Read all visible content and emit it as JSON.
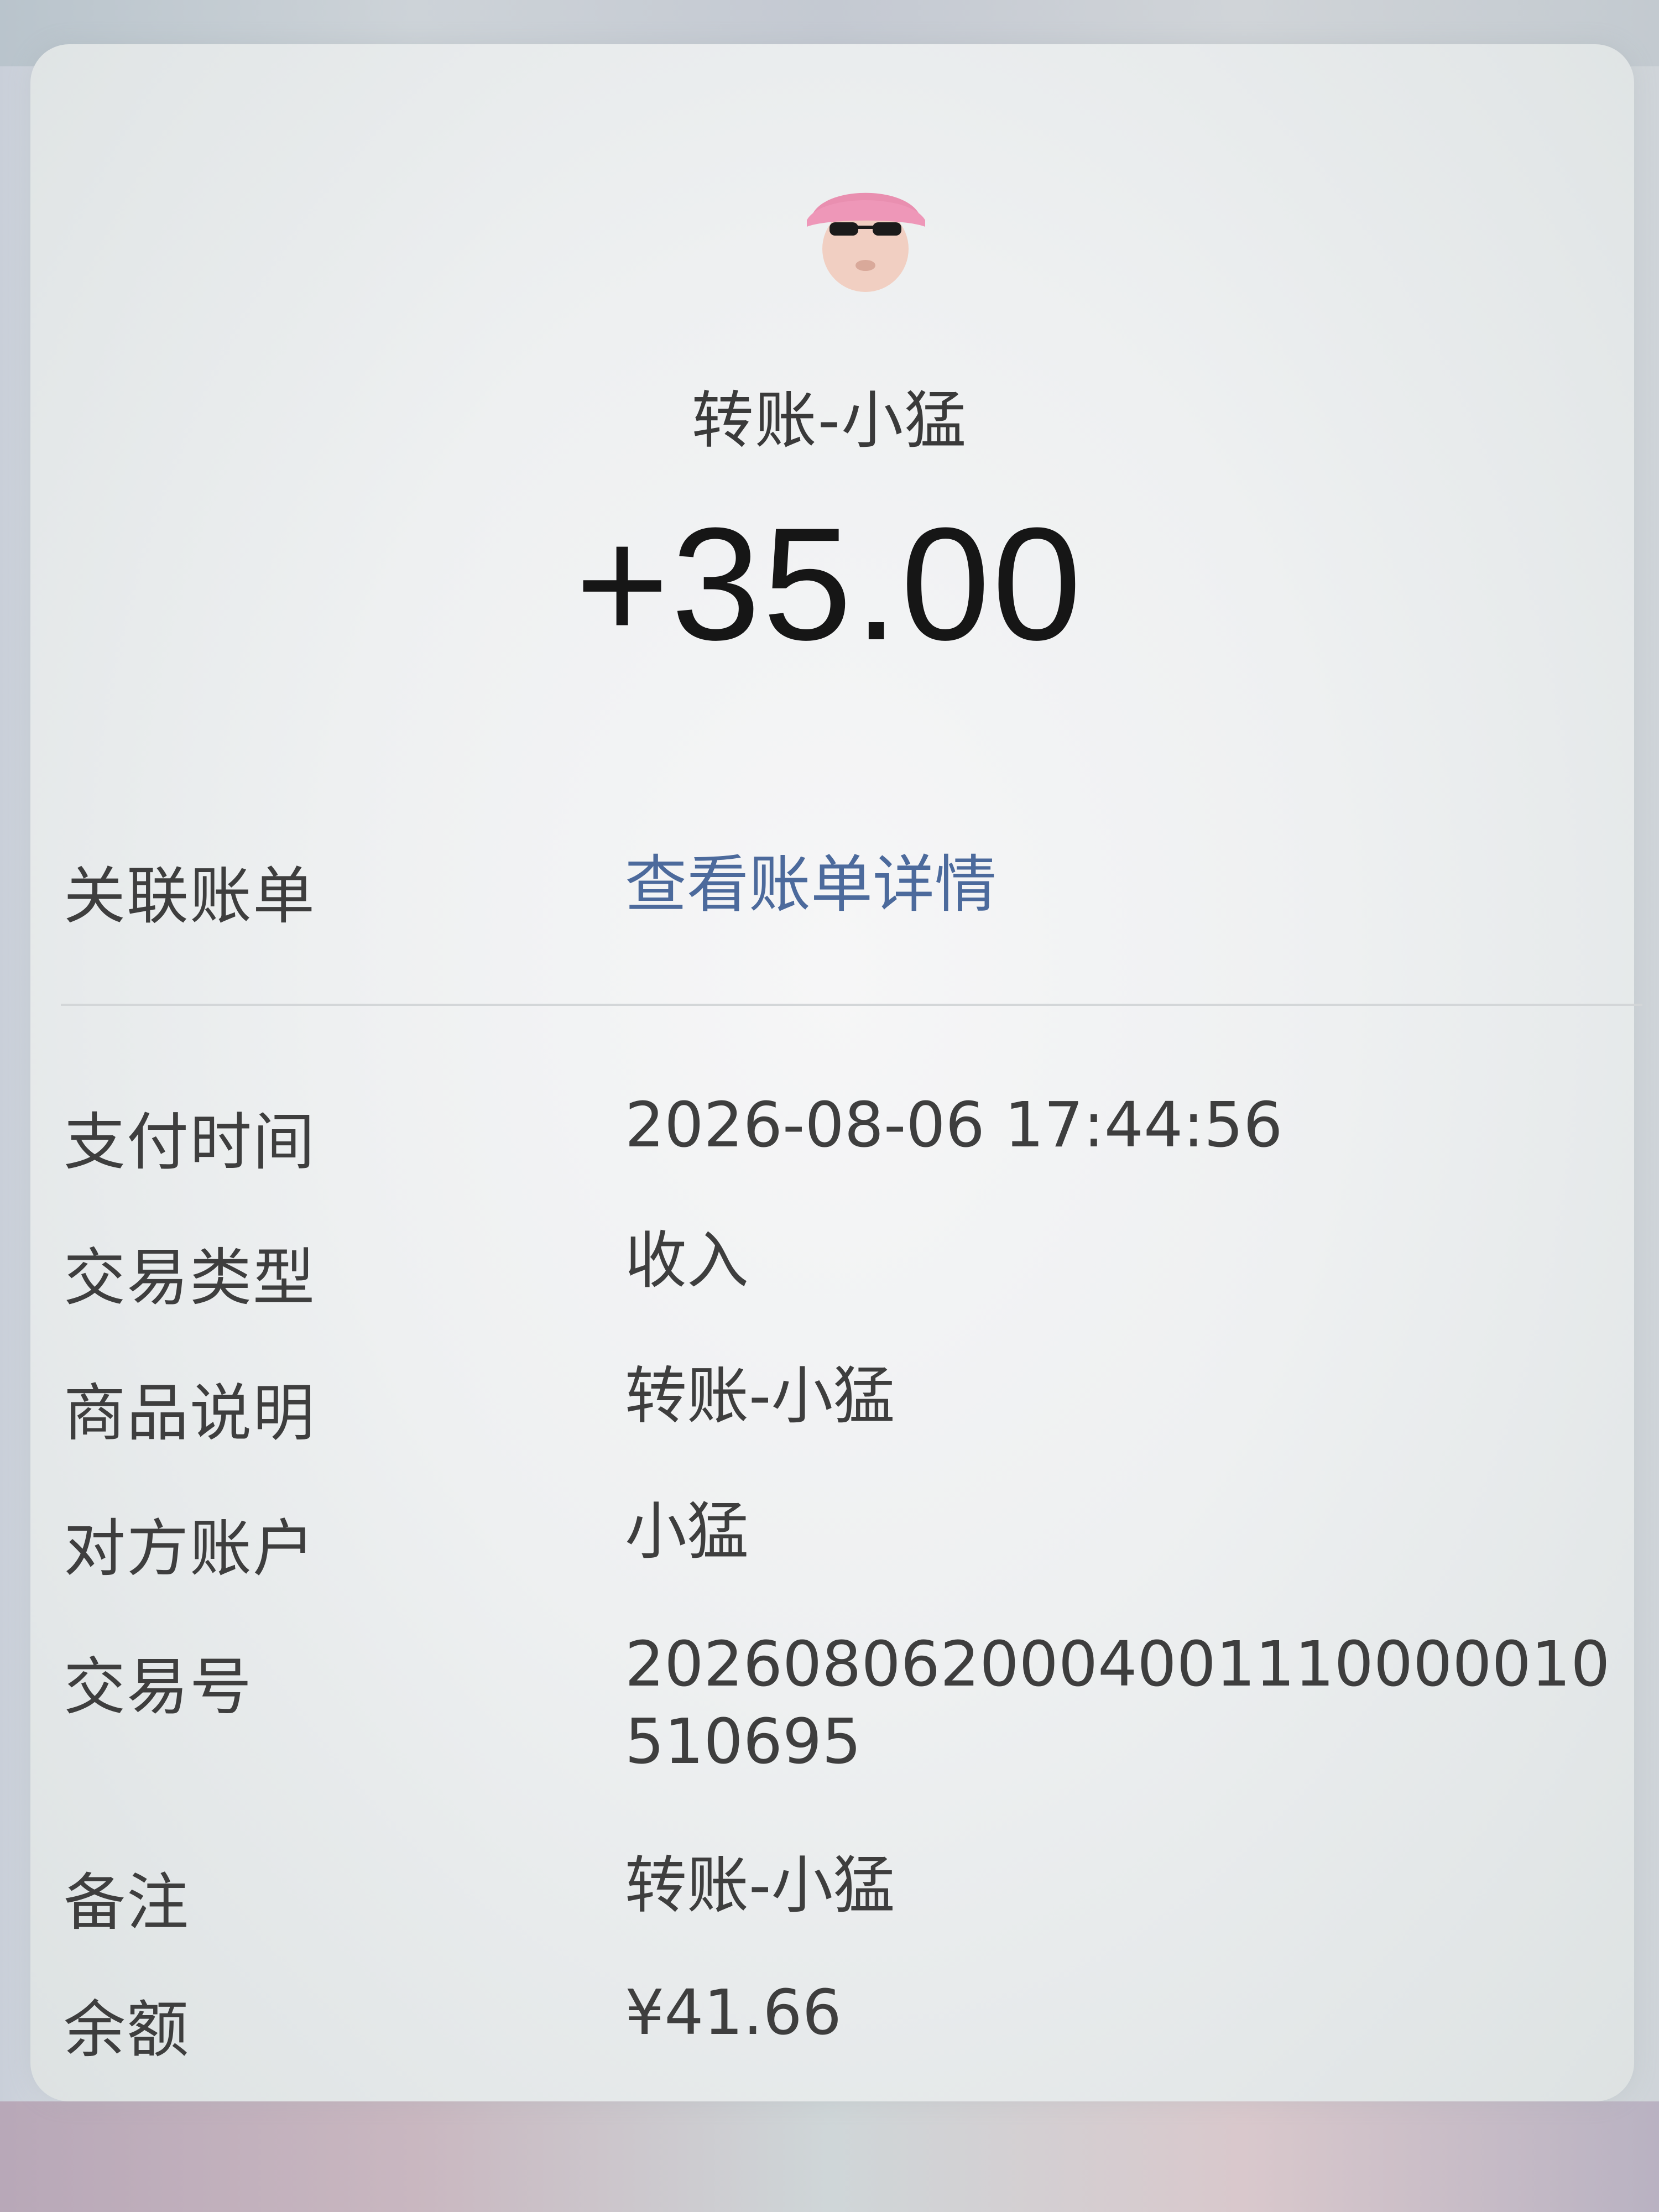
{
  "header": {
    "title": "转账-小猛",
    "amount": "+35.00"
  },
  "avatar": {
    "icon": "avatar-pink-hair-sunglasses",
    "hair_color": "#e98fb0",
    "skin_color": "#f1cfc2"
  },
  "related_bill": {
    "label": "关联账单",
    "link_text": "查看账单详情"
  },
  "details": [
    {
      "label": "支付时间",
      "value": "2026-08-06 17:44:56"
    },
    {
      "label": "交易类型",
      "value": "收入"
    },
    {
      "label": "商品说明",
      "value": "转账-小猛"
    },
    {
      "label": "对方账户",
      "value": "小猛"
    },
    {
      "label": "交易号",
      "value": "2026080620004001110000010510695"
    },
    {
      "label": "备注",
      "value": "转账-小猛"
    },
    {
      "label": "余额",
      "value": "¥41.66"
    }
  ],
  "colors": {
    "link": "#4c6a9c",
    "text": "#3e3e3e",
    "amount": "#161616"
  }
}
